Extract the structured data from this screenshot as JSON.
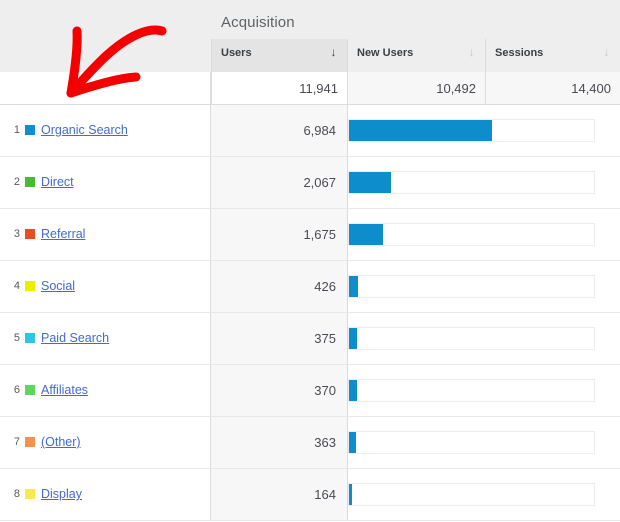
{
  "report": {
    "group_title": "Acquisition",
    "columns": [
      {
        "key": "users",
        "label": "Users",
        "sort_icon": "arrow-down-icon",
        "sort_active": true,
        "total": "11,941"
      },
      {
        "key": "newusers",
        "label": "New Users",
        "sort_icon": "arrow-down-icon",
        "sort_active": false,
        "total": "10,492"
      },
      {
        "key": "sessions",
        "label": "Sessions",
        "sort_icon": "arrow-down-icon",
        "sort_active": false,
        "total": "14,400"
      }
    ],
    "rows": [
      {
        "rank": "1",
        "name": "Organic Search",
        "users": "6,984",
        "bar_pct": 58.5,
        "swatch": "#0d8ecf"
      },
      {
        "rank": "2",
        "name": "Direct",
        "users": "2,067",
        "bar_pct": 17.3,
        "swatch": "#4aba34"
      },
      {
        "rank": "3",
        "name": "Referral",
        "users": "1,675",
        "bar_pct": 14.0,
        "swatch": "#eb4d20"
      },
      {
        "rank": "4",
        "name": "Social",
        "users": "426",
        "bar_pct": 3.6,
        "swatch": "#eded00"
      },
      {
        "rank": "5",
        "name": "Paid Search",
        "users": "375",
        "bar_pct": 3.1,
        "swatch": "#2fc3e8"
      },
      {
        "rank": "6",
        "name": "Affiliates",
        "users": "370",
        "bar_pct": 3.1,
        "swatch": "#5cd65c"
      },
      {
        "rank": "7",
        "name": "(Other)",
        "users": "363",
        "bar_pct": 3.0,
        "swatch": "#f9914b"
      },
      {
        "rank": "8",
        "name": "Display",
        "users": "164",
        "bar_pct": 1.4,
        "swatch": "#f7e94f"
      }
    ],
    "annotation": {
      "type": "hand-drawn-arrow",
      "color": "#f40000",
      "points_to": "dimension-column-header"
    }
  },
  "chart_data": {
    "type": "bar",
    "title": "Acquisition",
    "xlabel": "Users",
    "ylabel": "",
    "categories": [
      "Organic Search",
      "Direct",
      "Referral",
      "Social",
      "Paid Search",
      "Affiliates",
      "(Other)",
      "Display"
    ],
    "values": [
      6984,
      2067,
      1675,
      426,
      375,
      370,
      363,
      164
    ],
    "series": [
      {
        "name": "Users",
        "values": [
          6984,
          2067,
          1675,
          426,
          375,
          370,
          363,
          164
        ],
        "total": 11941
      },
      {
        "name": "New Users",
        "values": [],
        "total": 10492
      },
      {
        "name": "Sessions",
        "values": [],
        "total": 14400
      }
    ],
    "xlim": [
      0,
      11941
    ],
    "grid": false,
    "legend": "none",
    "bar_color": "#0e8dcd",
    "orientation": "horizontal"
  }
}
